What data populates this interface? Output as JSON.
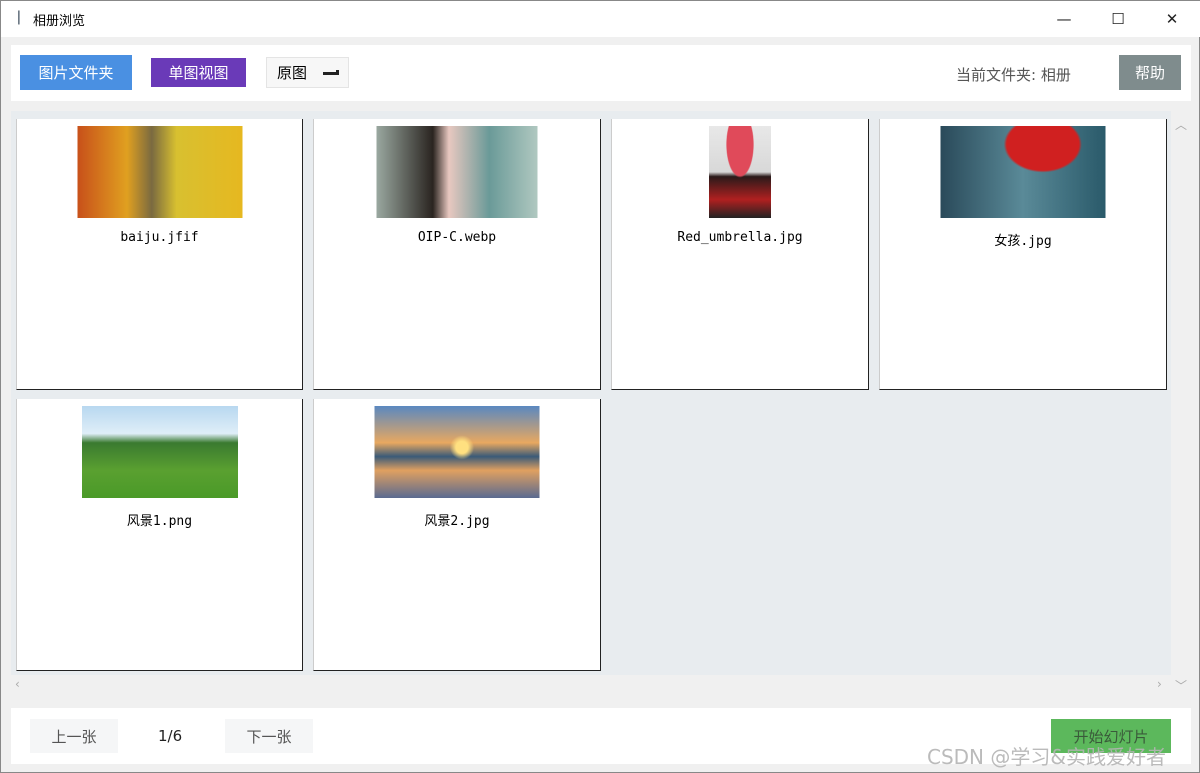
{
  "window": {
    "title": "相册浏览",
    "minimize": "—",
    "maximize": "☐",
    "close": "✕"
  },
  "toolbar": {
    "folder_button": "图片文件夹",
    "single_view_button": "单图视图",
    "size_select": "原图",
    "current_folder_label": "当前文件夹: 相册",
    "help_button": "帮助"
  },
  "colors": {
    "folder": "#4a90e2",
    "single": "#6a3ab8",
    "help": "#7f8c8d",
    "slideshow": "#5cb85c"
  },
  "images": [
    {
      "name": "baiju.jfif"
    },
    {
      "name": "OIP-C.webp"
    },
    {
      "name": "Red_umbrella.jpg"
    },
    {
      "name": "女孩.jpg"
    },
    {
      "name": "风景1.png"
    },
    {
      "name": "风景2.jpg"
    }
  ],
  "footer": {
    "prev_button": "上一张",
    "page": "1/6",
    "next_button": "下一张",
    "slideshow_button": "开始幻灯片"
  },
  "watermark": "CSDN @学习&实践爱好者"
}
